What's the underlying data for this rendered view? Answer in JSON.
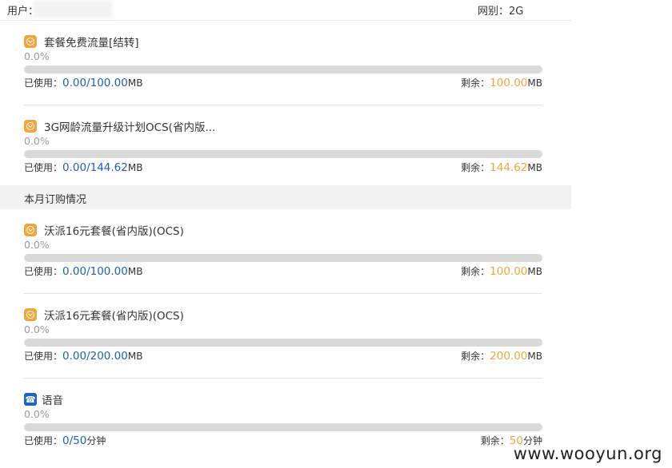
{
  "header": {
    "user_label": "用户：",
    "network_label": "网别：2G"
  },
  "section_title": "本月订购情况",
  "items": [
    {
      "title": "套餐免费流量[结转]",
      "percent_text": "0.0%",
      "progress": 0.0,
      "used_label": "已使用：",
      "used_value": "0.00/100.00",
      "used_unit": "MB",
      "remain_label": "剩余：",
      "remain_value": "100.00",
      "remain_unit": "MB"
    },
    {
      "title": "3G网龄流量升级计划OCS(省内版...",
      "percent_text": "0.0%",
      "progress": 0.0,
      "used_label": "已使用：",
      "used_value": "0.00/144.62",
      "used_unit": "MB",
      "remain_label": "剩余：",
      "remain_value": "144.62",
      "remain_unit": "MB"
    },
    {
      "title": "沃派16元套餐(省内版)(OCS)",
      "percent_text": "0.0%",
      "progress": 0.0,
      "used_label": "已使用：",
      "used_value": "0.00/100.00",
      "used_unit": "MB",
      "remain_label": "剩余：",
      "remain_value": "100.00",
      "remain_unit": "MB"
    },
    {
      "title": "沃派16元套餐(省内版)(OCS)",
      "percent_text": "0.0%",
      "progress": 0.0,
      "used_label": "已使用：",
      "used_value": "0.00/200.00",
      "used_unit": "MB",
      "remain_label": "剩余：",
      "remain_value": "200.00",
      "remain_unit": "MB"
    },
    {
      "title": "语音",
      "percent_text": "0.0%",
      "progress": 0.0,
      "used_label": "已使用：",
      "used_value": "0/50",
      "used_unit": "分钟",
      "remain_label": "剩余：",
      "remain_value": "50",
      "remain_unit": "分钟"
    }
  ],
  "icons": {
    "data_plan": "data-plan-icon",
    "voice": "phone-icon"
  },
  "colors": {
    "accent_orange": "#f2a53a",
    "used_blue": "#1e5fb0",
    "bar_gray": "#d9d9d9"
  },
  "watermark": "www.wooyun.org"
}
